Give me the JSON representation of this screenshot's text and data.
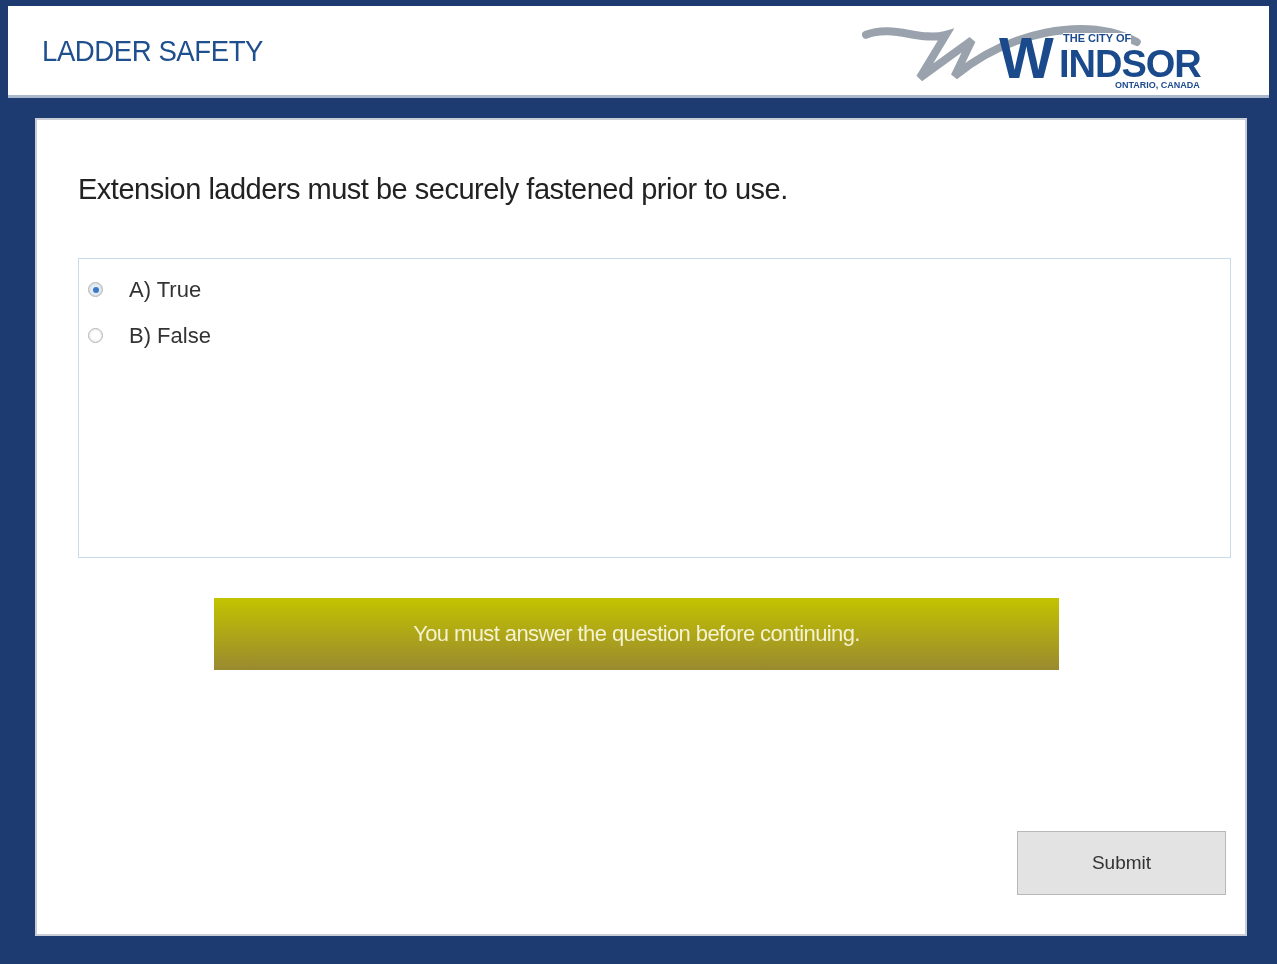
{
  "header": {
    "title": "LADDER SAFETY",
    "logo": {
      "top_line": "THE CITY OF",
      "initial": "W",
      "name": "INDSOR",
      "bottom_line": "ONTARIO, CANADA"
    }
  },
  "question": {
    "text": "Extension ladders must be securely fastened prior to use.",
    "options": [
      {
        "label": "A) True",
        "selected": true
      },
      {
        "label": "B) False",
        "selected": false
      }
    ]
  },
  "alert": {
    "text": "You must answer the question before continuing."
  },
  "submit_button": {
    "label": "Submit"
  }
}
